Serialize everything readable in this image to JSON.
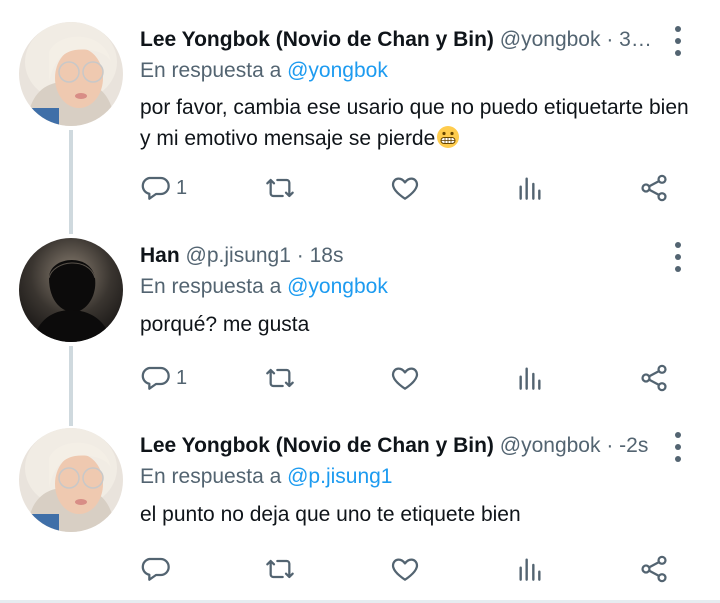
{
  "tweets": [
    {
      "name": "Lee Yongbok (Novio de Chan y Bin)",
      "handle": "@yongbok",
      "separator": "·",
      "time": "3…",
      "reply_prefix": "En respuesta a",
      "reply_to": "@yongbok",
      "text": "por favor, cambia ese usario que no puedo etiquetarte bien y mi emotivo mensaje se pierde",
      "emoji": "grimacing-face",
      "reply_count": "1"
    },
    {
      "name": "Han",
      "handle": "@p.jisung1",
      "separator": "·",
      "time": "18s",
      "reply_prefix": "En respuesta a",
      "reply_to": "@yongbok",
      "text": "porqué? me gusta",
      "reply_count": "1"
    },
    {
      "name": "Lee Yongbok (Novio de Chan y Bin)",
      "handle": "@yongbok",
      "separator": "·",
      "time": "-2s",
      "reply_prefix": "En respuesta a",
      "reply_to": "@p.jisung1",
      "text": "el punto no deja que uno te etiquete bien",
      "reply_count": ""
    }
  ],
  "icons": [
    "reply-icon",
    "retweet-icon",
    "like-icon",
    "analytics-icon",
    "share-icon",
    "more-options-icon"
  ],
  "colors": {
    "accent": "#1d9bf0",
    "secondary_text": "#536471",
    "thread_line": "#cfd9de"
  }
}
